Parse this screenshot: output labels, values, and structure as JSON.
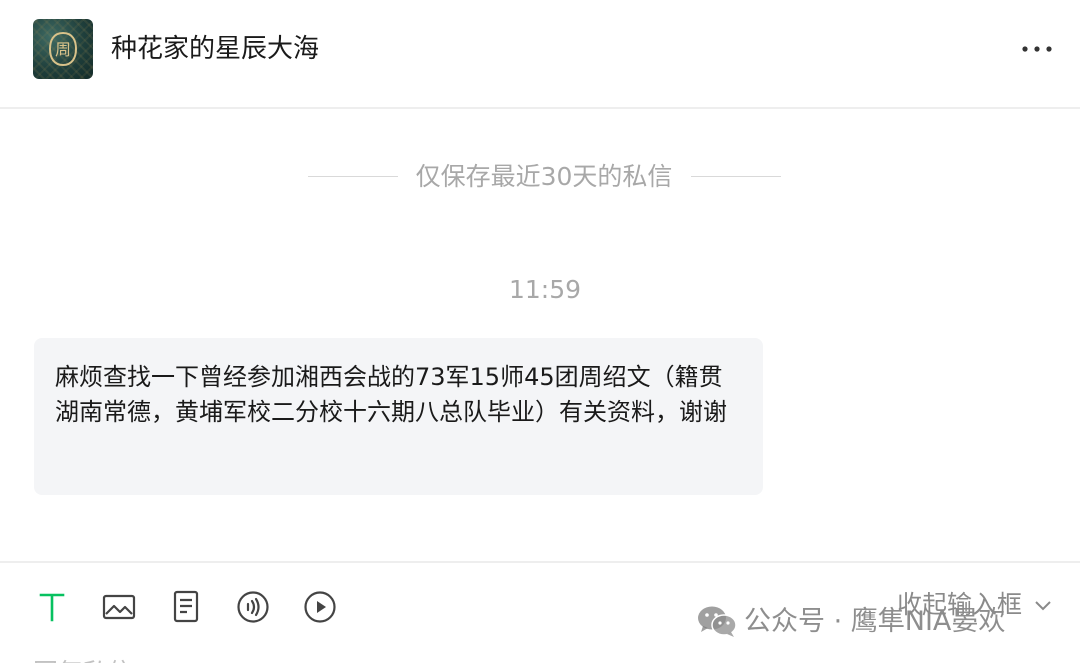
{
  "header": {
    "title": "种花家的星辰大海",
    "avatar_glyph": "周",
    "more_icon": "more-horizontal-icon"
  },
  "conversation": {
    "notice": "仅保存最近30天的私信",
    "timestamp": "11:59",
    "messages": [
      {
        "text": "麻烦查找一下曾经参加湘西会战的73军15师45团周绍文（籍贯湖南常德，黄埔军校二分校十六期八总队毕业）有关资料，谢谢"
      }
    ]
  },
  "toolbar": {
    "tools": [
      {
        "name": "text-icon"
      },
      {
        "name": "image-icon"
      },
      {
        "name": "document-icon"
      },
      {
        "name": "audio-icon"
      },
      {
        "name": "video-icon"
      }
    ],
    "collapse_label": "收起输入框",
    "reply_placeholder": "回复私信"
  },
  "watermark": {
    "text": "公众号 · 鹰隼NIA晏欢",
    "icon": "wechat-icon"
  },
  "colors": {
    "accent": "#07c160",
    "bubble": "#f4f5f7",
    "muted_text": "#a8a8a8"
  }
}
